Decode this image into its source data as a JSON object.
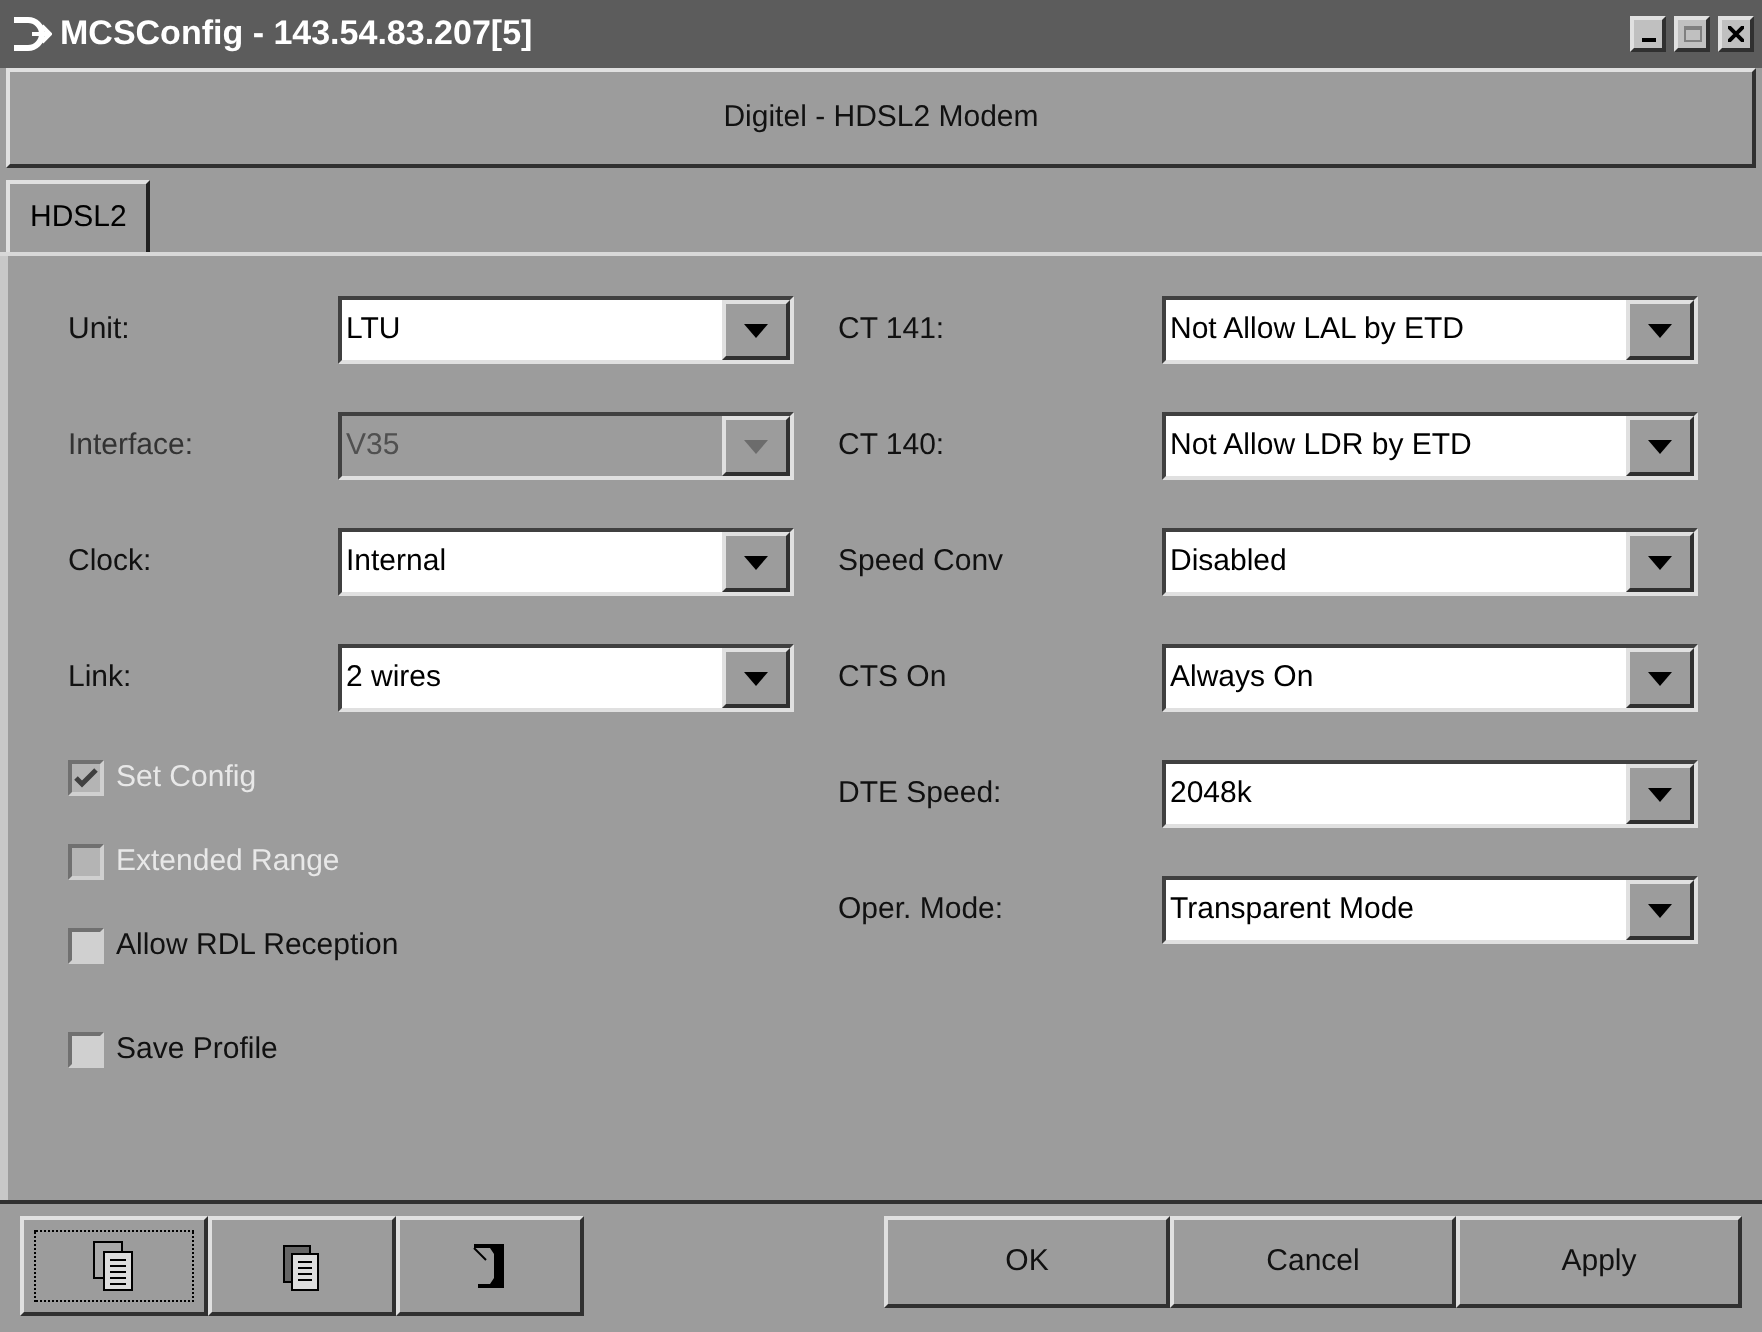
{
  "window": {
    "title": "MCSConfig - 143.54.83.207[5]"
  },
  "header": "Digitel - HDSL2 Modem",
  "tabs": [
    {
      "label": "HDSL2",
      "selected": true
    }
  ],
  "left_fields": [
    {
      "label": "Unit:",
      "value": "LTU",
      "disabled": false
    },
    {
      "label": "Interface:",
      "value": "V35",
      "disabled": true
    },
    {
      "label": "Clock:",
      "value": "Internal",
      "disabled": false
    },
    {
      "label": "Link:",
      "value": "2 wires",
      "disabled": false
    }
  ],
  "checkboxes": [
    {
      "label": "Set Config",
      "checked": true,
      "disabled": true
    },
    {
      "label": "Extended Range",
      "checked": false,
      "disabled": true
    },
    {
      "label": "Allow RDL Reception",
      "checked": false,
      "disabled": false
    },
    {
      "label": "Save Profile",
      "checked": false,
      "disabled": false
    }
  ],
  "right_fields": [
    {
      "label": "CT 141:",
      "value": "Not Allow LAL by ETD",
      "disabled": false
    },
    {
      "label": "CT 140:",
      "value": "Not Allow LDR by ETD",
      "disabled": false
    },
    {
      "label": "Speed Conv",
      "value": "Disabled",
      "disabled": false
    },
    {
      "label": "CTS On",
      "value": "Always On",
      "disabled": false
    },
    {
      "label": "DTE Speed:",
      "value": "2048k",
      "disabled": false
    },
    {
      "label": "Oper. Mode:",
      "value": "Transparent Mode",
      "disabled": false
    }
  ],
  "toolbar_buttons": [
    {
      "kind": "copy",
      "selected": true
    },
    {
      "kind": "paste",
      "selected": false
    },
    {
      "kind": "exit",
      "selected": false
    }
  ],
  "buttons": [
    "OK",
    "Cancel",
    "Apply"
  ]
}
